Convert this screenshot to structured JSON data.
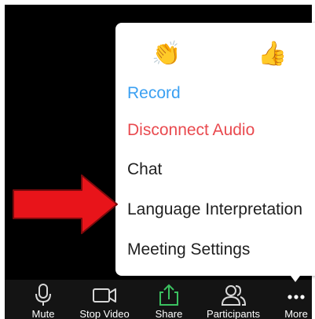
{
  "menu": {
    "reactions": [
      {
        "name": "clap",
        "icon": "clapping-hands-icon",
        "glyph": "👏"
      },
      {
        "name": "thumbs-up",
        "icon": "thumbs-up-icon",
        "glyph": "👍"
      }
    ],
    "items": [
      {
        "label": "Record",
        "color": "#3aa0f2"
      },
      {
        "label": "Disconnect Audio",
        "color": "#e94a4f"
      },
      {
        "label": "Chat",
        "color": "#1f1f1f"
      },
      {
        "label": "Language Interpretation",
        "color": "#1f1f1f"
      },
      {
        "label": "Meeting Settings",
        "color": "#1f1f1f"
      }
    ]
  },
  "toolbar": {
    "items": [
      {
        "label": "Mute",
        "icon": "microphone-icon"
      },
      {
        "label": "Stop Video",
        "icon": "video-camera-icon"
      },
      {
        "label": "Share",
        "icon": "share-arrow-icon",
        "color": "#3bc160"
      },
      {
        "label": "Participants",
        "icon": "participants-icon"
      },
      {
        "label": "More",
        "icon": "more-dots-icon"
      }
    ]
  },
  "annotation": {
    "arrow_color": "#e8141a",
    "arrow_icon": "red-arrow-icon"
  }
}
